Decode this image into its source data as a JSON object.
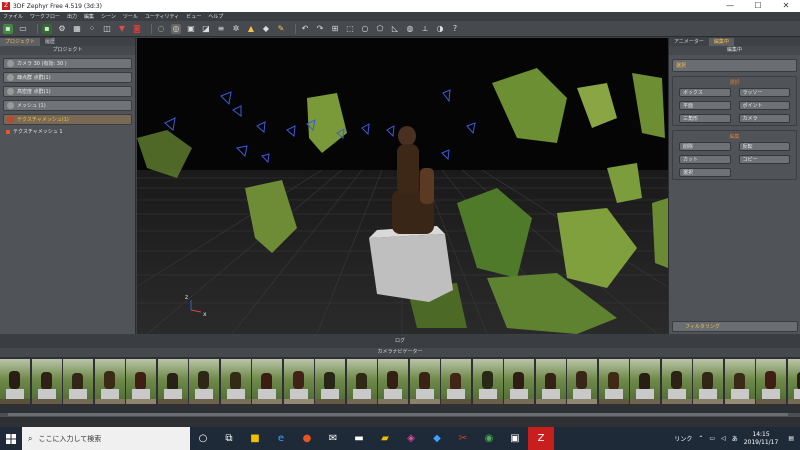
{
  "window": {
    "title": "3DF Zephyr Free 4.519 (3d:3)",
    "controls": [
      "—",
      "☐",
      "✕"
    ]
  },
  "menu": [
    "ファイル",
    "ワークフロー",
    "出力",
    "編集",
    "シーン",
    "ツール",
    "ユーティリティ",
    "ビュー",
    "ヘルプ"
  ],
  "toolbar": {
    "icons": [
      "save-icon",
      "camera-icon",
      "undo-icon",
      "redo-icon",
      "help-icon"
    ]
  },
  "left_panel": {
    "tabs": [
      "プロジェクト",
      "履歴"
    ],
    "header": "プロジェクト",
    "items": [
      {
        "label": "カメラ 30 (有効: 30 )"
      },
      {
        "label": "疎点群 点群(1)"
      },
      {
        "label": "高密度 点群(1)"
      },
      {
        "label": "メッシュ (1)"
      },
      {
        "label": "テクスチャメッシュ(1)"
      }
    ],
    "sub_item": "テクスチャメッシュ 1"
  },
  "viewport": {
    "axis_z": "z",
    "axis_x": "x"
  },
  "right_panel": {
    "tabs": [
      "アニメーター",
      "編集中"
    ],
    "header": "編集中",
    "select_label": "選択",
    "selection_title": "選択",
    "selection_buttons": [
      "ボックス",
      "ラッソー",
      "平面",
      "ポイント",
      "三角形",
      "カメラ"
    ],
    "edit_title": "編集",
    "edit_buttons": [
      "削除",
      "反転",
      "カット",
      "コピー",
      "選択"
    ],
    "bottom_button": "フィルタリング"
  },
  "log_label": "ログ",
  "filmstrip": {
    "title": "カメラナビゲーター",
    "count": 30
  },
  "taskbar": {
    "search_placeholder": "ここに入力して検索",
    "tray_text": "リンク",
    "ime": "あ",
    "time": "14:15",
    "date": "2019/11/17"
  },
  "colors": {
    "accent": "#f2c14e",
    "brand": "#c81e1e",
    "taskbar": "#1f2a38"
  }
}
